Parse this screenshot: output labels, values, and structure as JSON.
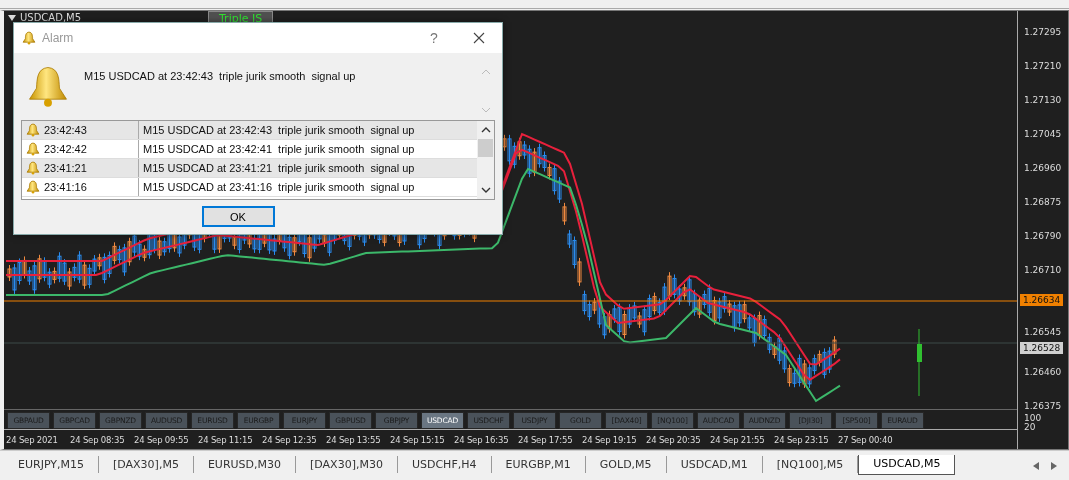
{
  "chart_window": {
    "title": "USDCAD,M5",
    "indicator_tab": "Triple JS"
  },
  "price_axis": {
    "labels": [
      "1.27295",
      "1.27210",
      "1.27130",
      "1.27045",
      "1.26960",
      "1.26875",
      "1.26790",
      "1.26710",
      "1.26545",
      "1.26460",
      "1.26375"
    ],
    "markers": [
      {
        "kind": "line",
        "text": "1.26634"
      },
      {
        "kind": "bid",
        "text": "1.26528"
      }
    ],
    "subwindow_labels": [
      "100",
      "20"
    ]
  },
  "symbol_buttons": [
    {
      "label": "GBPAUD",
      "selected": false
    },
    {
      "label": "GBPCAD",
      "selected": false
    },
    {
      "label": "GBPNZD",
      "selected": false
    },
    {
      "label": "AUDUSD",
      "selected": false
    },
    {
      "label": "EURUSD",
      "selected": false
    },
    {
      "label": "EURGBP",
      "selected": false
    },
    {
      "label": "EURJPY",
      "selected": false
    },
    {
      "label": "GBPUSD",
      "selected": false
    },
    {
      "label": "GBPJPY",
      "selected": false
    },
    {
      "label": "USDCAD",
      "selected": true
    },
    {
      "label": "USDCHF",
      "selected": false
    },
    {
      "label": "USDJPY",
      "selected": false
    },
    {
      "label": "GOLD",
      "selected": false
    },
    {
      "label": "[DAX40]",
      "selected": false
    },
    {
      "label": "[NQ100]",
      "selected": false
    },
    {
      "label": "AUDCAD",
      "selected": false
    },
    {
      "label": "AUDNZD",
      "selected": false
    },
    {
      "label": "[DJI30]",
      "selected": false
    },
    {
      "label": "[SP500]",
      "selected": false
    },
    {
      "label": "EURAUD",
      "selected": false
    }
  ],
  "time_axis": [
    "24 Sep 2021",
    "24 Sep 08:35",
    "24 Sep 09:55",
    "24 Sep 11:15",
    "24 Sep 12:35",
    "24 Sep 13:55",
    "24 Sep 15:15",
    "24 Sep 16:35",
    "24 Sep 17:55",
    "24 Sep 19:15",
    "24 Sep 20:35",
    "24 Sep 21:55",
    "24 Sep 23:15",
    "27 Sep 00:40"
  ],
  "chart_tabs": [
    {
      "label": "EURJPY,M15",
      "selected": false
    },
    {
      "label": "[DAX30],M5",
      "selected": false
    },
    {
      "label": "EURUSD,M30",
      "selected": false
    },
    {
      "label": "[DAX30],M30",
      "selected": false
    },
    {
      "label": "USDCHF,H4",
      "selected": false
    },
    {
      "label": "EURGBP,M1",
      "selected": false
    },
    {
      "label": "GOLD,M5",
      "selected": false
    },
    {
      "label": "USDCAD,M1",
      "selected": false
    },
    {
      "label": "[NQ100],M5",
      "selected": false
    },
    {
      "label": "USDCAD,M5",
      "selected": true
    }
  ],
  "dialog": {
    "title": "Alarm",
    "help": "?",
    "message": "M15 USDCAD at 23:42:43  triple jurik smooth  signal up",
    "alerts": [
      {
        "time": "23:42:43",
        "message": "M15 USDCAD at 23:42:43  triple jurik smooth  signal up"
      },
      {
        "time": "23:42:42",
        "message": "M15 USDCAD at 23:42:41  triple jurik smooth  signal up"
      },
      {
        "time": "23:41:21",
        "message": "M15 USDCAD at 23:41:21  triple jurik smooth  signal up"
      },
      {
        "time": "23:41:16",
        "message": "M15 USDCAD at 23:41:16  triple jurik smooth  signal up"
      }
    ],
    "ok_button": "OK"
  }
}
